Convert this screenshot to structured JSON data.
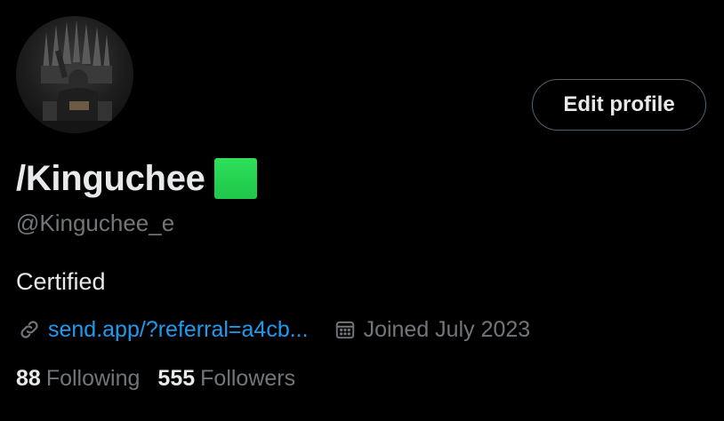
{
  "profile": {
    "display_name": "/Kinguchee",
    "handle": "@Kinguchee_e",
    "bio": "Certified",
    "link_text": "send.app/?referral=a4cb...",
    "joined_text": "Joined July 2023",
    "edit_button_label": "Edit profile",
    "following_count": "88",
    "following_label": "Following",
    "followers_count": "555",
    "followers_label": "Followers"
  },
  "icons": {
    "link": "link-icon",
    "calendar": "calendar-icon",
    "name_badge": "green-square-emoji"
  },
  "colors": {
    "background": "#000000",
    "primary_text": "#e7e9ea",
    "secondary_text": "#71767b",
    "link": "#1d9bf0",
    "button_border": "#536471",
    "badge_green": "#26d04f"
  }
}
